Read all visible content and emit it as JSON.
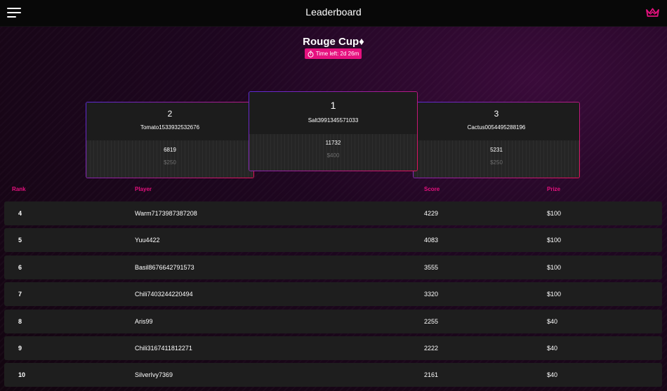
{
  "topbar": {
    "title": "Leaderboard",
    "menu_icon": "hamburger-menu-icon",
    "logo_icon": "crown-icon",
    "accent": "#e6117f"
  },
  "cup": {
    "title": "Rouge Cup♦",
    "timer": "Time left: 2d 26m"
  },
  "podium": {
    "first": {
      "rank": "1",
      "name": "Salt3991345571033",
      "score": "11732",
      "prize": "$400"
    },
    "second": {
      "rank": "2",
      "name": "Tomato1533932532676",
      "score": "6819",
      "prize": "$250"
    },
    "third": {
      "rank": "3",
      "name": "Cactus0054495288196",
      "score": "5231",
      "prize": "$250"
    }
  },
  "table": {
    "headers": {
      "rank": "Rank",
      "player": "Player",
      "score": "Score",
      "prize": "Prize"
    },
    "rows": [
      {
        "rank": "4",
        "player": "Warm7173987387208",
        "score": "4229",
        "prize": "$100"
      },
      {
        "rank": "5",
        "player": "Yuu4422",
        "score": "4083",
        "prize": "$100"
      },
      {
        "rank": "6",
        "player": "Basil8676642791573",
        "score": "3555",
        "prize": "$100"
      },
      {
        "rank": "7",
        "player": "Chili7403244220494",
        "score": "3320",
        "prize": "$100"
      },
      {
        "rank": "8",
        "player": "Aris99",
        "score": "2255",
        "prize": "$40"
      },
      {
        "rank": "9",
        "player": "Chili3167411812271",
        "score": "2222",
        "prize": "$40"
      },
      {
        "rank": "10",
        "player": "SilverIvy7369",
        "score": "2161",
        "prize": "$40"
      }
    ]
  }
}
